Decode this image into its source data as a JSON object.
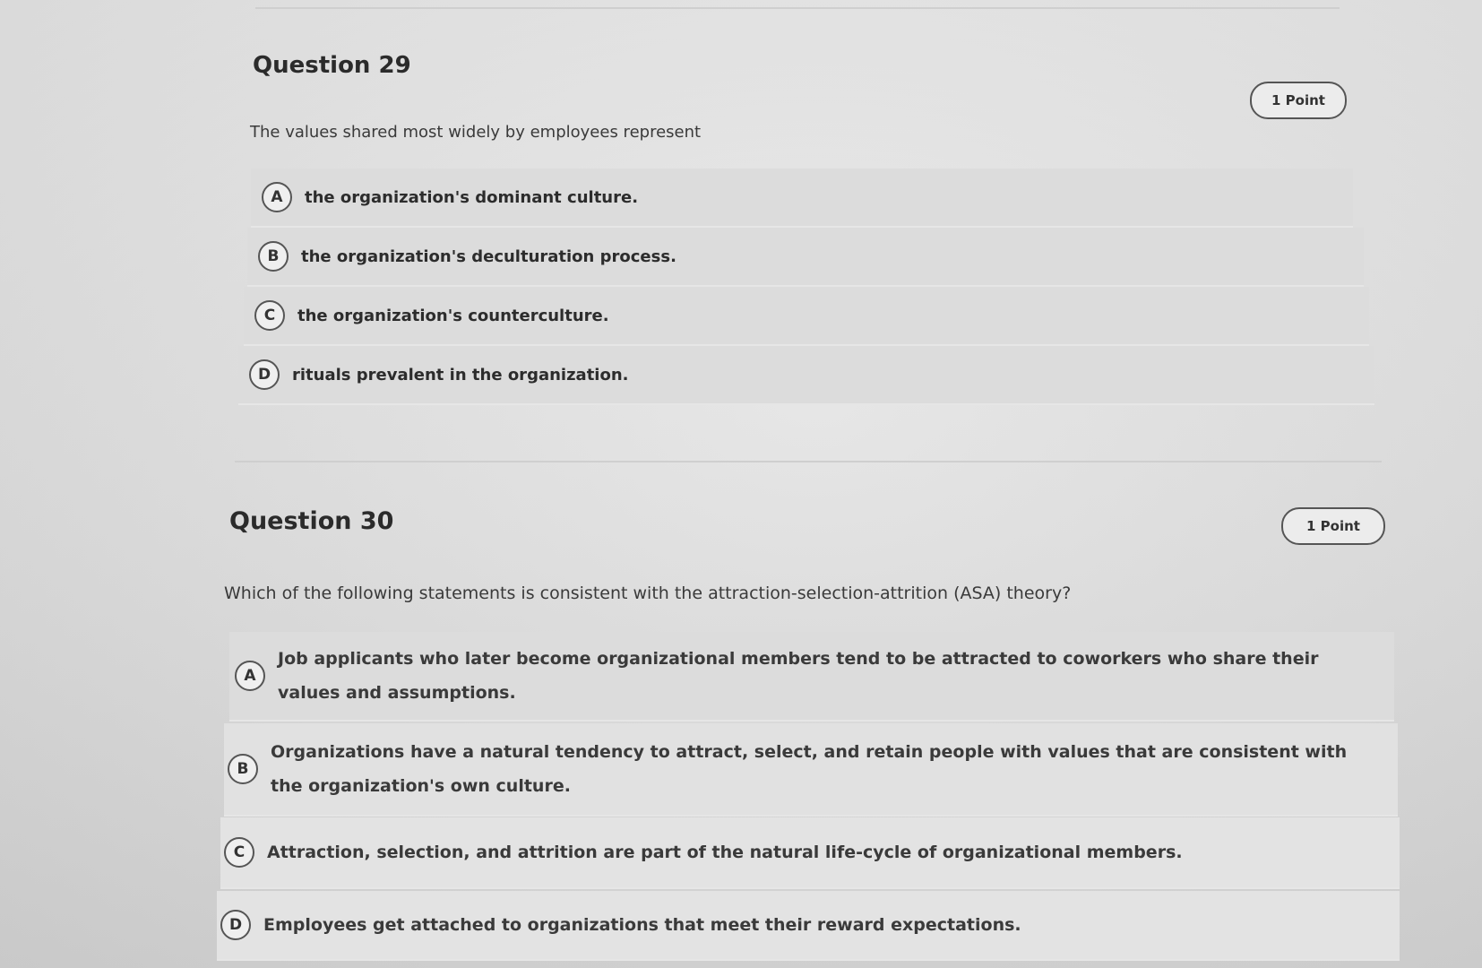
{
  "q29": {
    "title": "Question 29",
    "points": "1 Point",
    "prompt": "The values shared most widely by employees represent",
    "options": [
      {
        "letter": "A",
        "text": "the organization's dominant culture."
      },
      {
        "letter": "B",
        "text": "the organization's deculturation process."
      },
      {
        "letter": "C",
        "text": "the organization's counterculture."
      },
      {
        "letter": "D",
        "text": "rituals prevalent in the organization."
      }
    ]
  },
  "q30": {
    "title": "Question 30",
    "points": "1 Point",
    "prompt": "Which of the following statements is consistent with the attraction-selection-attrition (ASA) theory?",
    "options": [
      {
        "letter": "A",
        "text": "Job applicants who later become organizational members tend to be attracted to coworkers who share their values and assumptions."
      },
      {
        "letter": "B",
        "text": "Organizations have a natural tendency to attract, select, and retain people with values that are consistent with the organization's own culture."
      },
      {
        "letter": "C",
        "text": "Attraction, selection, and attrition are part of the natural life-cycle of organizational members."
      },
      {
        "letter": "D",
        "text": "Employees get attached to organizations that meet their reward expectations."
      }
    ]
  }
}
